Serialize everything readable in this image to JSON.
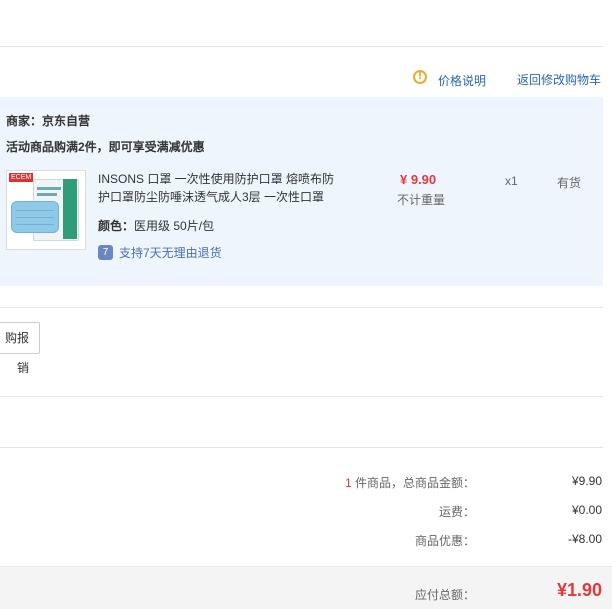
{
  "header": {
    "price_note_icon": "exclamation-circle-icon",
    "price_note": "价格说明",
    "back_to_cart": "返回修改购物车"
  },
  "shop": {
    "merchant_label": "商家：京东自营",
    "promo": "活动商品购满2件，即可享受满减优惠"
  },
  "item": {
    "title": "INSONS 口罩 一次性使用防护口罩 熔喷布防护口罩防尘防唾沫透气成人3层 一次性口罩",
    "color_label": "颜色：",
    "color_value": "医用级 50片/包",
    "return_icon": "7",
    "return_text": "支持7天无理由退货",
    "price": "¥ 9.90",
    "weight": "不计重量",
    "qty": "x1",
    "stock": "有货",
    "thumb_brand": "ECEM"
  },
  "invoice": {
    "button": "购报销"
  },
  "summary": {
    "count": "1",
    "count_label": "件商品，总商品金额：",
    "subtotal": "¥9.90",
    "shipping_label": "运费：",
    "shipping": "¥0.00",
    "discount_label": "商品优惠：",
    "discount": "-¥8.00",
    "total_label": "应付总额：",
    "total": "¥1.90"
  },
  "colors": {
    "accent_red": "#e4393c",
    "link_blue": "#2d66b5",
    "shop_bg": "#eef5fd"
  }
}
